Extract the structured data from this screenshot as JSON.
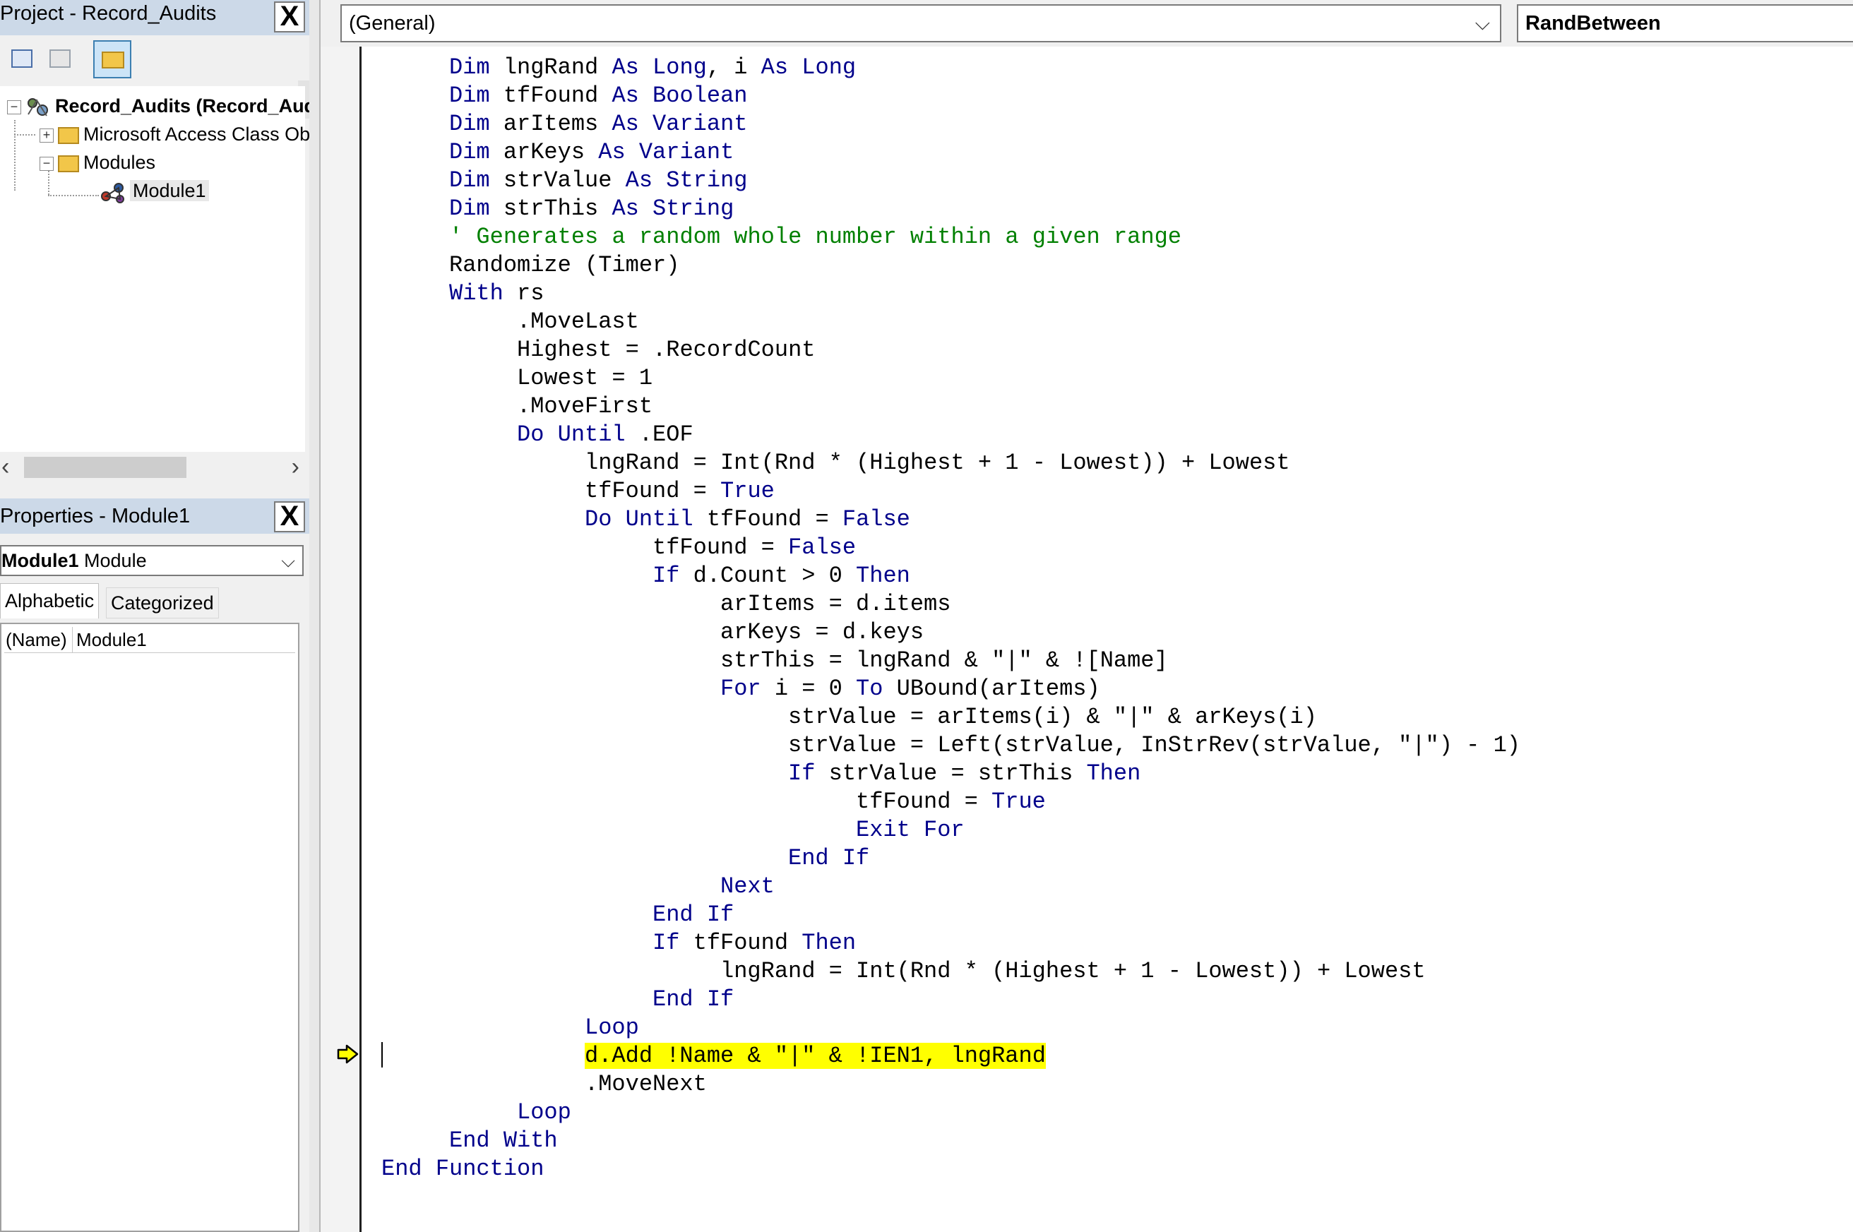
{
  "project_explorer": {
    "title": "Project - Record_Audits",
    "close_label": "X",
    "tree": {
      "root": "Record_Audits (Record_Audits)",
      "class_objects": "Microsoft Access Class Objects",
      "modules": "Modules",
      "module1": "Module1"
    }
  },
  "properties": {
    "title": "Properties - Module1",
    "close_label": "X",
    "object_name": "Module1",
    "object_type": "Module",
    "tabs": [
      "Alphabetic",
      "Categorized"
    ],
    "rows": [
      {
        "key": "(Name)",
        "value": "Module1"
      }
    ]
  },
  "code_window": {
    "object_combo": "(General)",
    "procedure_combo": "RandBetween",
    "highlight_color": "#ffff00",
    "keyword_color": "#00008b",
    "comment_color": "#008000",
    "lines": [
      {
        "indent": 1,
        "segs": [
          [
            "k",
            "Dim"
          ],
          [
            "n",
            " lngRand "
          ],
          [
            "k",
            "As Long"
          ],
          [
            "n",
            ", i "
          ],
          [
            "k",
            "As Long"
          ]
        ]
      },
      {
        "indent": 1,
        "segs": [
          [
            "k",
            "Dim"
          ],
          [
            "n",
            " tfFound "
          ],
          [
            "k",
            "As Boolean"
          ]
        ]
      },
      {
        "indent": 1,
        "segs": [
          [
            "k",
            "Dim"
          ],
          [
            "n",
            " arItems "
          ],
          [
            "k",
            "As Variant"
          ]
        ]
      },
      {
        "indent": 1,
        "segs": [
          [
            "k",
            "Dim"
          ],
          [
            "n",
            " arKeys "
          ],
          [
            "k",
            "As Variant"
          ]
        ]
      },
      {
        "indent": 1,
        "segs": [
          [
            "k",
            "Dim"
          ],
          [
            "n",
            " strValue "
          ],
          [
            "k",
            "As String"
          ]
        ]
      },
      {
        "indent": 1,
        "segs": [
          [
            "k",
            "Dim"
          ],
          [
            "n",
            " strThis "
          ],
          [
            "k",
            "As String"
          ]
        ]
      },
      {
        "indent": 1,
        "segs": [
          [
            "c",
            "' Generates a random whole number within a given range"
          ]
        ]
      },
      {
        "indent": 1,
        "segs": [
          [
            "n",
            "Randomize (Timer)"
          ]
        ]
      },
      {
        "indent": 1,
        "segs": [
          [
            "k",
            "With"
          ],
          [
            "n",
            " rs"
          ]
        ]
      },
      {
        "indent": 2,
        "segs": [
          [
            "n",
            ".MoveLast"
          ]
        ]
      },
      {
        "indent": 2,
        "segs": [
          [
            "n",
            "Highest = .RecordCount"
          ]
        ]
      },
      {
        "indent": 2,
        "segs": [
          [
            "n",
            "Lowest = 1"
          ]
        ]
      },
      {
        "indent": 2,
        "segs": [
          [
            "n",
            ".MoveFirst"
          ]
        ]
      },
      {
        "indent": 2,
        "segs": [
          [
            "k",
            "Do Until"
          ],
          [
            "n",
            " .EOF"
          ]
        ]
      },
      {
        "indent": 3,
        "segs": [
          [
            "n",
            "lngRand = Int(Rnd * (Highest + 1 - Lowest)) + Lowest"
          ]
        ]
      },
      {
        "indent": 3,
        "segs": [
          [
            "n",
            "tfFound = "
          ],
          [
            "k",
            "True"
          ]
        ]
      },
      {
        "indent": 3,
        "segs": [
          [
            "k",
            "Do Until"
          ],
          [
            "n",
            " tfFound = "
          ],
          [
            "k",
            "False"
          ]
        ]
      },
      {
        "indent": 4,
        "segs": [
          [
            "n",
            "tfFound = "
          ],
          [
            "k",
            "False"
          ]
        ]
      },
      {
        "indent": 4,
        "segs": [
          [
            "k",
            "If"
          ],
          [
            "n",
            " d.Count > 0 "
          ],
          [
            "k",
            "Then"
          ]
        ]
      },
      {
        "indent": 5,
        "segs": [
          [
            "n",
            "arItems = d.items"
          ]
        ]
      },
      {
        "indent": 5,
        "segs": [
          [
            "n",
            "arKeys = d.keys"
          ]
        ]
      },
      {
        "indent": 5,
        "segs": [
          [
            "n",
            "strThis = lngRand & \"|\" & ![Name]"
          ]
        ]
      },
      {
        "indent": 5,
        "segs": [
          [
            "k",
            "For"
          ],
          [
            "n",
            " i = 0 "
          ],
          [
            "k",
            "To"
          ],
          [
            "n",
            " UBound(arItems)"
          ]
        ]
      },
      {
        "indent": 6,
        "segs": [
          [
            "n",
            "strValue = arItems(i) & \"|\" & arKeys(i)"
          ]
        ]
      },
      {
        "indent": 6,
        "segs": [
          [
            "n",
            "strValue = Left(strValue, InStrRev(strValue, \"|\") - 1)"
          ]
        ]
      },
      {
        "indent": 6,
        "segs": [
          [
            "k",
            "If"
          ],
          [
            "n",
            " strValue = strThis "
          ],
          [
            "k",
            "Then"
          ]
        ]
      },
      {
        "indent": 7,
        "segs": [
          [
            "n",
            "tfFound = "
          ],
          [
            "k",
            "True"
          ]
        ]
      },
      {
        "indent": 7,
        "segs": [
          [
            "k",
            "Exit For"
          ]
        ]
      },
      {
        "indent": 6,
        "segs": [
          [
            "k",
            "End If"
          ]
        ]
      },
      {
        "indent": 5,
        "segs": [
          [
            "k",
            "Next"
          ]
        ]
      },
      {
        "indent": 4,
        "segs": [
          [
            "k",
            "End If"
          ]
        ]
      },
      {
        "indent": 4,
        "segs": [
          [
            "k",
            "If"
          ],
          [
            "n",
            " tfFound "
          ],
          [
            "k",
            "Then"
          ]
        ]
      },
      {
        "indent": 5,
        "segs": [
          [
            "n",
            "lngRand = Int(Rnd * (Highest + 1 - Lowest)) + Lowest"
          ]
        ]
      },
      {
        "indent": 4,
        "segs": [
          [
            "k",
            "End If"
          ]
        ]
      },
      {
        "indent": 3,
        "segs": [
          [
            "k",
            "Loop"
          ]
        ]
      },
      {
        "indent": 3,
        "highlight": true,
        "segs": [
          [
            "n",
            "d.Add !Name & \"|\" & !IEN1, lngRand"
          ]
        ]
      },
      {
        "indent": 3,
        "segs": [
          [
            "n",
            ".MoveNext"
          ]
        ]
      },
      {
        "indent": 2,
        "segs": [
          [
            "k",
            "Loop"
          ]
        ]
      },
      {
        "indent": 1,
        "segs": [
          [
            "k",
            "End With"
          ]
        ]
      },
      {
        "indent": 0,
        "segs": [
          [
            "k",
            "End Function"
          ]
        ]
      }
    ]
  }
}
